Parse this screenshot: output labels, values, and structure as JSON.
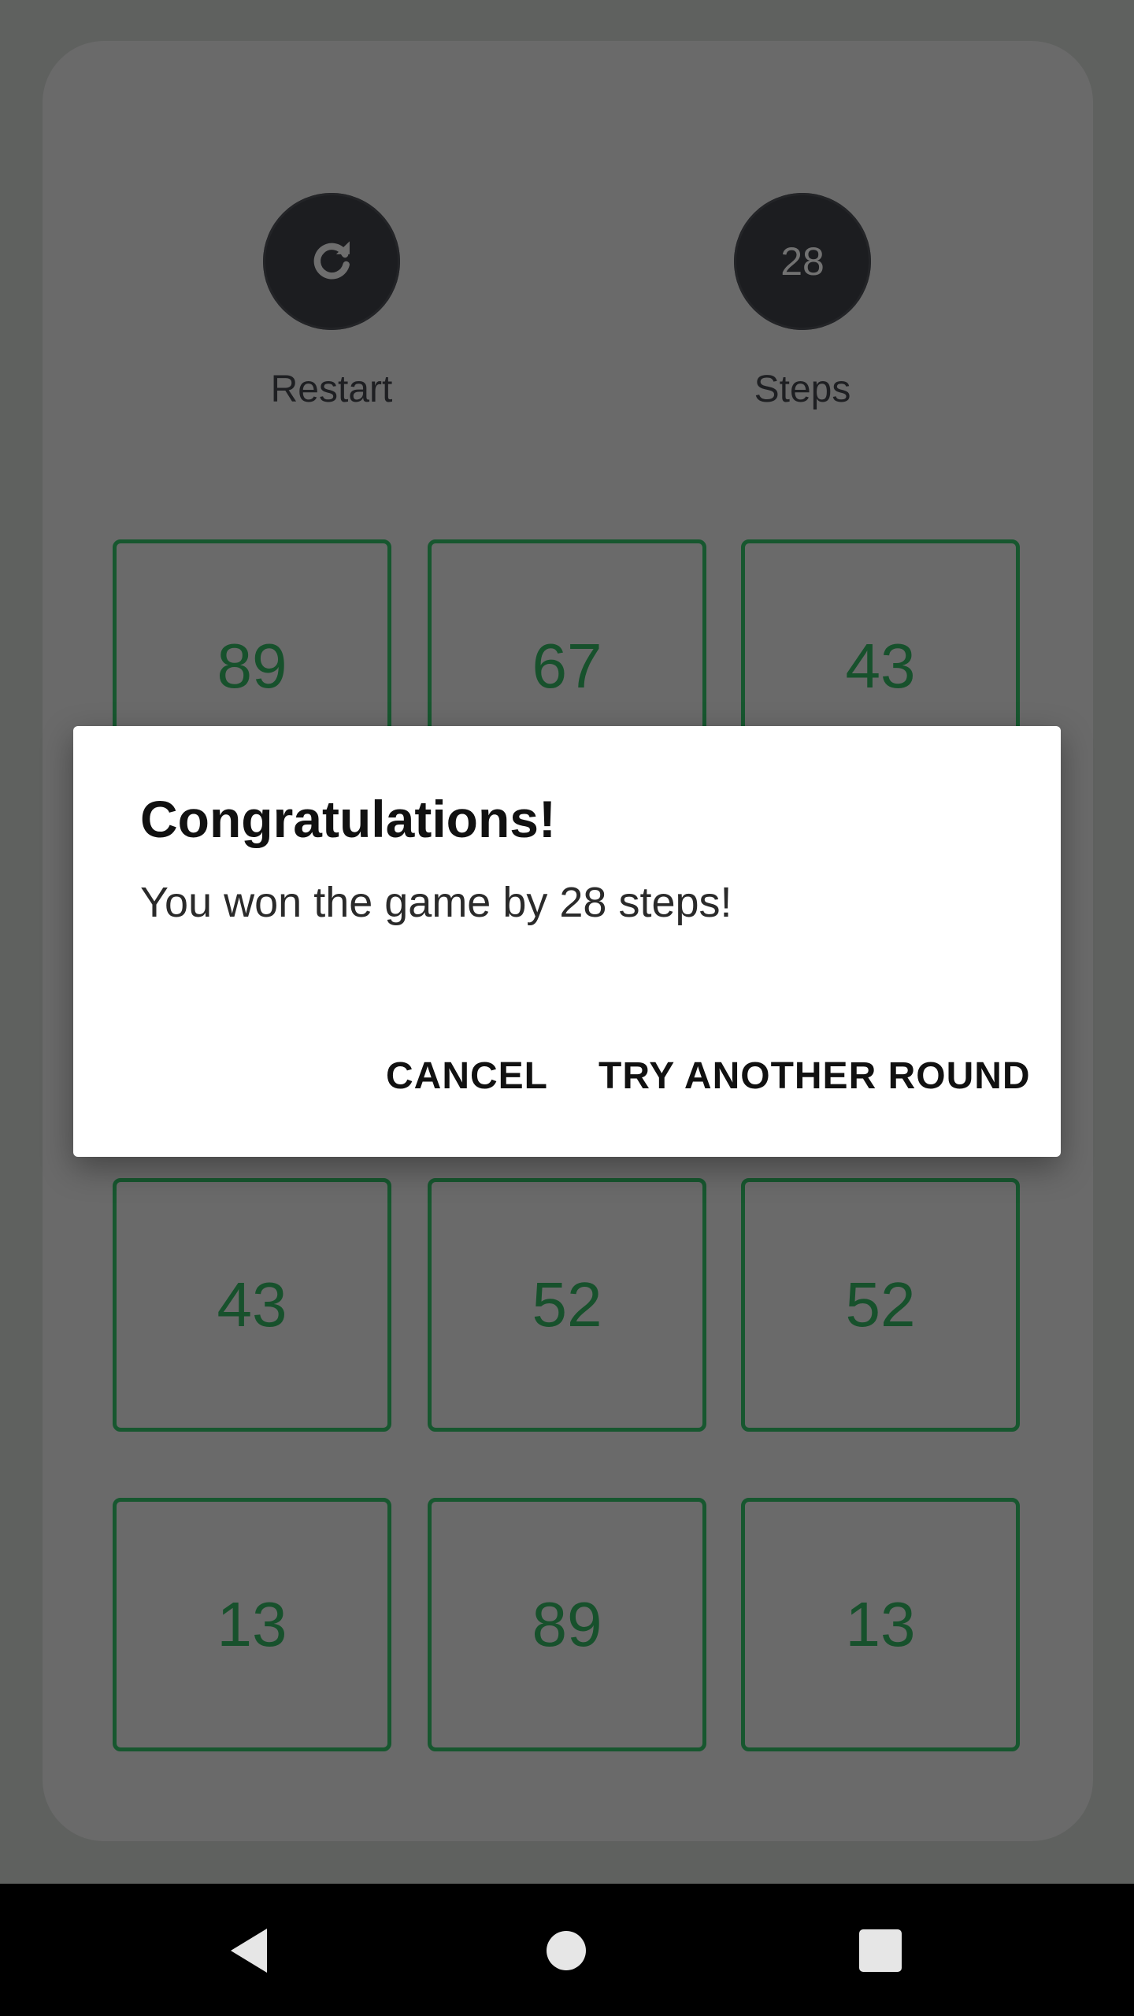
{
  "controls": {
    "restart_label": "Restart",
    "steps_label": "Steps",
    "steps_value": "28",
    "restart_icon": "refresh-icon"
  },
  "grid": {
    "visible_tiles": [
      "89",
      "67",
      "43",
      "43",
      "52",
      "52",
      "13",
      "89",
      "13"
    ]
  },
  "dialog": {
    "title": "Congratulations!",
    "message": "You won the game by 28 steps!",
    "cancel_label": "CANCEL",
    "confirm_label": "TRY ANOTHER ROUND"
  },
  "navbar": {
    "back_icon": "back-triangle-icon",
    "home_icon": "home-circle-icon",
    "recents_icon": "recents-square-icon"
  },
  "colors": {
    "scrim": "#5f615f",
    "card": "#6a6a6a",
    "tile_border": "#17572f",
    "tile_text": "#17512c",
    "control_circle": "#1c1d20",
    "dialog_bg": "#ffffff"
  }
}
